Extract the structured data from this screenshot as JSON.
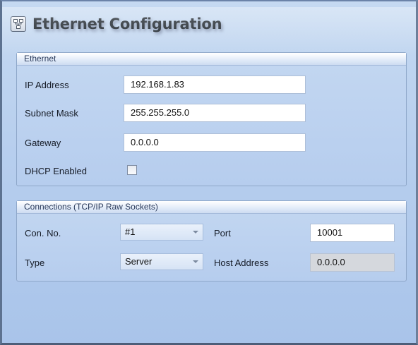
{
  "window": {
    "title": "Ethernet Configuration",
    "icon": "network-icon"
  },
  "ethernet": {
    "header": "Ethernet",
    "ip_address": {
      "label": "IP Address",
      "value": "192.168.1.83"
    },
    "subnet_mask": {
      "label": "Subnet Mask",
      "value": "255.255.255.0"
    },
    "gateway": {
      "label": "Gateway",
      "value": "0.0.0.0"
    },
    "dhcp": {
      "label": "DHCP Enabled",
      "checked": false
    }
  },
  "connections": {
    "header": "Connections (TCP/IP Raw Sockets)",
    "con_no": {
      "label": "Con. No.",
      "value": "#1"
    },
    "port": {
      "label": "Port",
      "value": "10001"
    },
    "type": {
      "label": "Type",
      "value": "Server"
    },
    "host_address": {
      "label": "Host Address",
      "value": "0.0.0.0"
    }
  }
}
